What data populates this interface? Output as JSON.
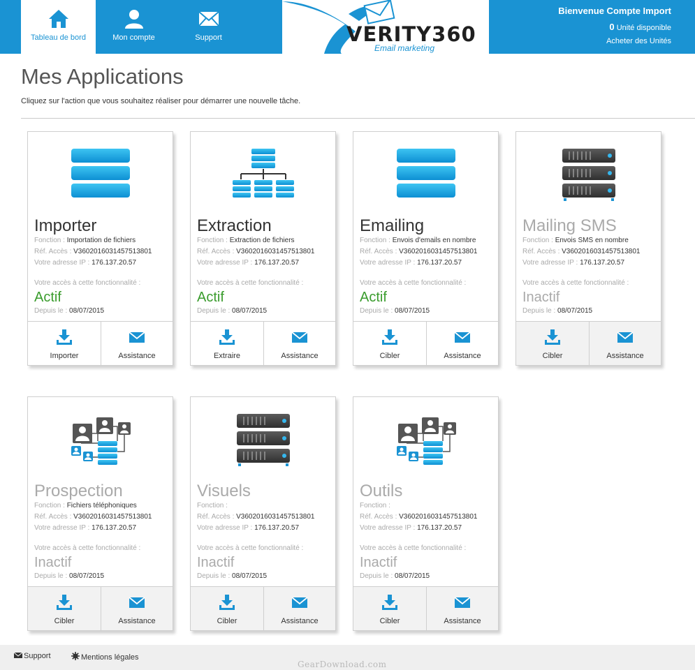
{
  "nav": {
    "items": [
      {
        "label": "Tableau de bord",
        "icon": "home-icon",
        "active": true
      },
      {
        "label": "Mon compte",
        "icon": "user-icon",
        "active": false
      },
      {
        "label": "Support",
        "icon": "envelope-icon",
        "active": false
      }
    ]
  },
  "logo": {
    "text": "VERITY360",
    "subtitle": "Email marketing"
  },
  "account": {
    "welcome": "Bienvenue Compte Import",
    "units_count": "0",
    "units_label": "Unité disponible",
    "buy_link": "Acheter des Unités"
  },
  "page": {
    "title": "Mes Applications",
    "subtitle": "Cliquez sur l'action que vous souhaitez réaliser pour démarrer une nouvelle tâche."
  },
  "labels": {
    "fonction": "Fonction :",
    "ref": "Réf. Accès :",
    "ip": "Votre adresse IP :",
    "access": "Votre accès à cette fonctionnalité :",
    "depuis": "Depuis le :"
  },
  "colors": {
    "brand": "#1a93d3",
    "active_status": "#3a9c2d",
    "inactive_status": "#aaaaaa"
  },
  "cards": [
    {
      "title": "Importer",
      "fonction": "Importation de fichiers",
      "ref": "V3602016031457513801",
      "ip": "176.137.20.57",
      "status": "Actif",
      "since": "08/07/2015",
      "icon": "database-blue-icon",
      "action1": "Importer",
      "action2": "Assistance"
    },
    {
      "title": "Extraction",
      "fonction": "Extraction de fichiers",
      "ref": "V3602016031457513801",
      "ip": "176.137.20.57",
      "status": "Actif",
      "since": "08/07/2015",
      "icon": "database-tree-icon",
      "action1": "Extraire",
      "action2": "Assistance"
    },
    {
      "title": "Emailing",
      "fonction": "Envois d'emails en nombre",
      "ref": "V3602016031457513801",
      "ip": "176.137.20.57",
      "status": "Actif",
      "since": "08/07/2015",
      "icon": "database-blue-icon",
      "action1": "Cibler",
      "action2": "Assistance"
    },
    {
      "title": "Mailing SMS",
      "fonction": "Envois SMS en nombre",
      "ref": "V3602016031457513801",
      "ip": "176.137.20.57",
      "status": "Inactif",
      "since": "08/07/2015",
      "icon": "server-icon",
      "action1": "Cibler",
      "action2": "Assistance"
    },
    {
      "title": "Prospection",
      "fonction": "Fichiers téléphoniques",
      "ref": "V3602016031457513801",
      "ip": "176.137.20.57",
      "status": "Inactif",
      "since": "08/07/2015",
      "icon": "network-users-icon",
      "action1": "Cibler",
      "action2": "Assistance"
    },
    {
      "title": "Visuels",
      "fonction": "",
      "ref": "V3602016031457513801",
      "ip": "176.137.20.57",
      "status": "Inactif",
      "since": "08/07/2015",
      "icon": "server-icon",
      "action1": "Cibler",
      "action2": "Assistance"
    },
    {
      "title": "Outils",
      "fonction": "",
      "ref": "V3602016031457513801",
      "ip": "176.137.20.57",
      "status": "Inactif",
      "since": "08/07/2015",
      "icon": "network-users-icon",
      "action1": "Cibler",
      "action2": "Assistance"
    }
  ],
  "footer": {
    "support": "Support",
    "legal": "Mentions légales"
  },
  "watermark": "GearDownload.com"
}
